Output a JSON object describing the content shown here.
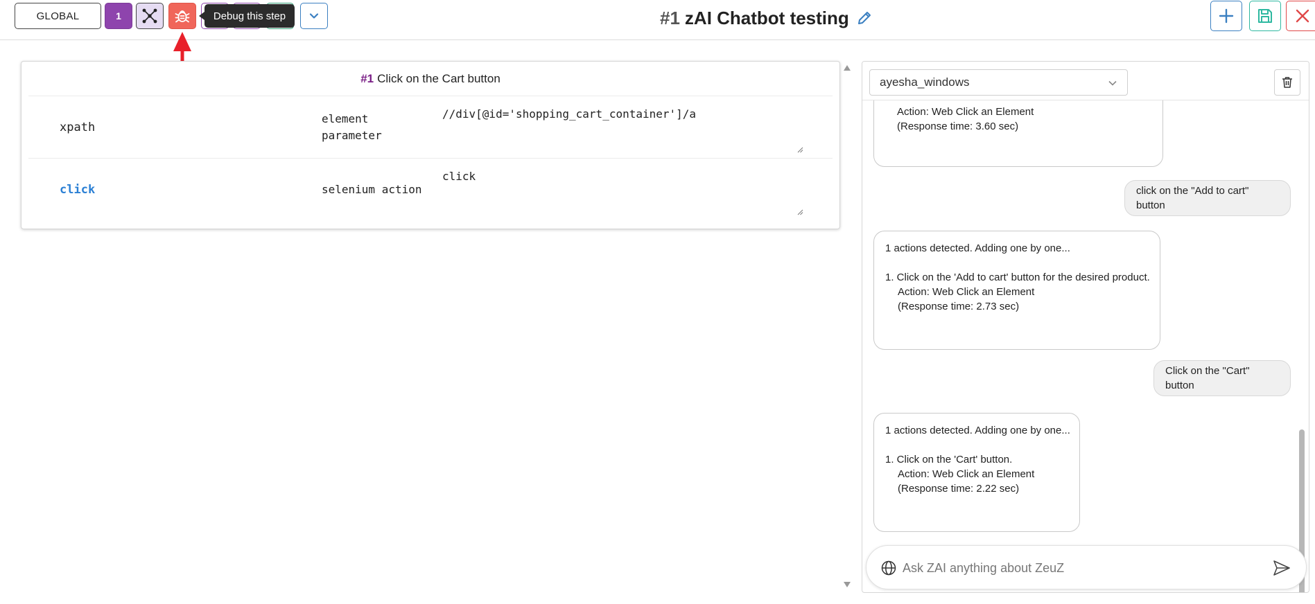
{
  "toolbar": {
    "global_label": "GLOBAL",
    "step_number": "1",
    "tooltip": "Debug this step"
  },
  "header": {
    "number": "#1",
    "title": "zAI Chatbot testing"
  },
  "step": {
    "number": "#1",
    "title": "Click on the Cart button",
    "rows": [
      {
        "field": "xpath",
        "type_line1": "element",
        "type_line2": "parameter",
        "value": "//div[@id='shopping_cart_container']/a"
      },
      {
        "field": "click",
        "type_line1": "selenium action",
        "type_line2": "",
        "value": "click"
      }
    ]
  },
  "chat": {
    "selected_user": "ayesha_windows",
    "messages": [
      {
        "role": "bot",
        "lines": [
          "Action: Web Click an Element",
          "(Response time: 3.60 sec)"
        ]
      },
      {
        "role": "user",
        "text": "click on the \"Add to cart\" button"
      },
      {
        "role": "bot",
        "lines": [
          "1 actions detected. Adding one by one...",
          "",
          "1. Click on the 'Add to cart' button for the desired product.",
          "Action: Web Click an Element",
          "(Response time: 2.73 sec)"
        ]
      },
      {
        "role": "user",
        "text": "Click on the \"Cart\" button"
      },
      {
        "role": "bot",
        "lines": [
          "1 actions detected. Adding one by one...",
          "",
          "1. Click on the 'Cart' button.",
          "Action: Web Click an Element",
          "(Response time: 2.22 sec)"
        ]
      }
    ],
    "input_placeholder": "Ask ZAI anything about ZeuZ"
  },
  "colors": {
    "step_button": "#8e44ad",
    "debug_button": "#f0665a",
    "link_blue": "#2a7fd4",
    "annotation_red": "#e8202a"
  },
  "icons": [
    "graph-icon",
    "bug-icon",
    "chevron-down-icon",
    "pencil-icon",
    "plus-icon",
    "save-icon",
    "close-icon",
    "trash-icon",
    "globe-icon",
    "send-icon"
  ]
}
